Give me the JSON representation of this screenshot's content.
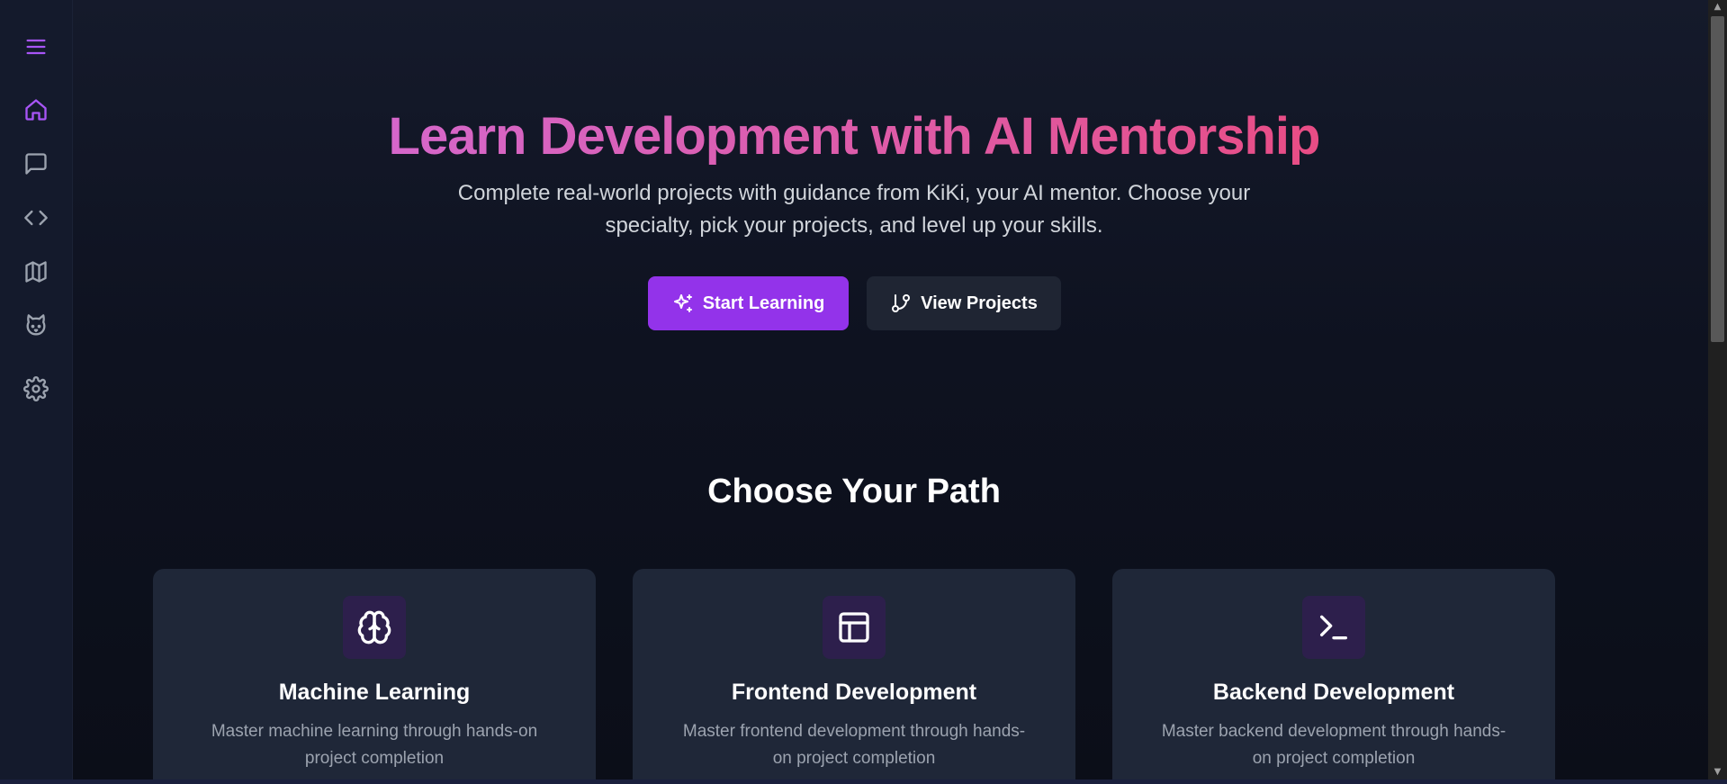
{
  "sidebar": {
    "items": [
      {
        "name": "menu",
        "icon": "menu-icon"
      },
      {
        "name": "home",
        "icon": "home-icon",
        "active": true
      },
      {
        "name": "chat",
        "icon": "chat-icon"
      },
      {
        "name": "code",
        "icon": "code-icon"
      },
      {
        "name": "map",
        "icon": "map-icon"
      },
      {
        "name": "mentor",
        "icon": "cat-icon"
      },
      {
        "name": "settings",
        "icon": "gear-icon"
      }
    ],
    "accent_color": "#a855f7",
    "icon_color": "#9ca3af"
  },
  "hero": {
    "title": "Learn Development with AI Mentorship",
    "subtitle": "Complete real-world projects with guidance from KiKi, your AI mentor. Choose your specialty, pick your projects, and level up your skills.",
    "primary_button": {
      "label": "Start Learning",
      "icon": "sparkles-icon",
      "color": "#9333ea"
    },
    "secondary_button": {
      "label": "View Projects",
      "icon": "git-branch-icon",
      "color": "#1f2533"
    }
  },
  "paths": {
    "title": "Choose Your Path",
    "cards": [
      {
        "title": "Machine Learning",
        "description": "Master machine learning through hands-on project completion",
        "icon": "brain-icon"
      },
      {
        "title": "Frontend Development",
        "description": "Master frontend development through hands-on project completion",
        "icon": "layout-icon"
      },
      {
        "title": "Backend Development",
        "description": "Master backend development through hands-on project completion",
        "icon": "terminal-icon"
      }
    ]
  }
}
